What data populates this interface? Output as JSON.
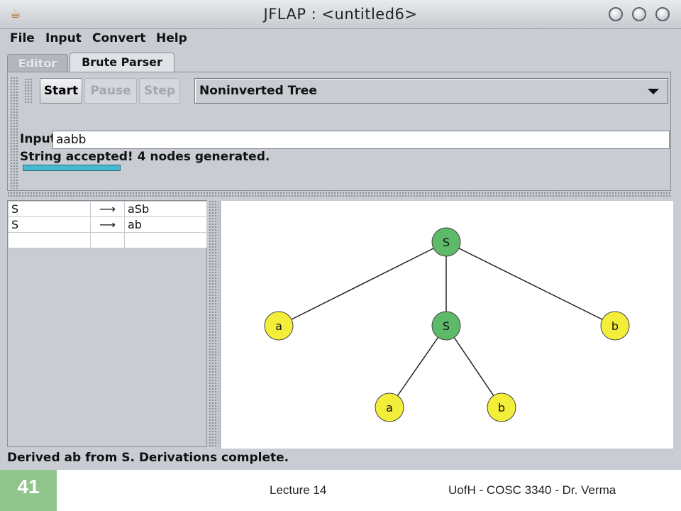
{
  "window": {
    "title": "JFLAP : <untitled6>",
    "app_icon": "java-cup-icon"
  },
  "menu": [
    "File",
    "Input",
    "Convert",
    "Help"
  ],
  "tabs": [
    {
      "label": "Editor",
      "active": false
    },
    {
      "label": "Brute Parser",
      "active": true
    }
  ],
  "toolbar": {
    "start": "Start",
    "pause": "Pause",
    "step": "Step",
    "view_select": "Noninverted Tree"
  },
  "input": {
    "label": "Input",
    "value": "aabb"
  },
  "status": {
    "message": "String accepted!  4 nodes generated.",
    "progress": 1.0
  },
  "grammar": {
    "arrow": "⟶",
    "rules": [
      {
        "lhs": "S",
        "rhs": "aSb"
      },
      {
        "lhs": "S",
        "rhs": "ab"
      },
      {
        "lhs": "",
        "rhs": ""
      }
    ]
  },
  "tree": {
    "colors": {
      "nonterminal": "#5cba68",
      "terminal": "#f2ee3a",
      "edge": "#222222"
    },
    "nodes": [
      {
        "id": "root",
        "label": "S",
        "kind": "nonterminal"
      },
      {
        "id": "a1",
        "label": "a",
        "kind": "terminal"
      },
      {
        "id": "s2",
        "label": "S",
        "kind": "nonterminal"
      },
      {
        "id": "b1",
        "label": "b",
        "kind": "terminal"
      },
      {
        "id": "a2",
        "label": "a",
        "kind": "terminal"
      },
      {
        "id": "b2",
        "label": "b",
        "kind": "terminal"
      }
    ],
    "edges": [
      [
        "root",
        "a1"
      ],
      [
        "root",
        "s2"
      ],
      [
        "root",
        "b1"
      ],
      [
        "s2",
        "a2"
      ],
      [
        "s2",
        "b2"
      ]
    ]
  },
  "statusbar": "Derived ab from S.  Derivations complete.",
  "footer": {
    "slide_number": "41",
    "center": "Lecture 14",
    "right": "UofH - COSC 3340 - Dr. Verma"
  }
}
